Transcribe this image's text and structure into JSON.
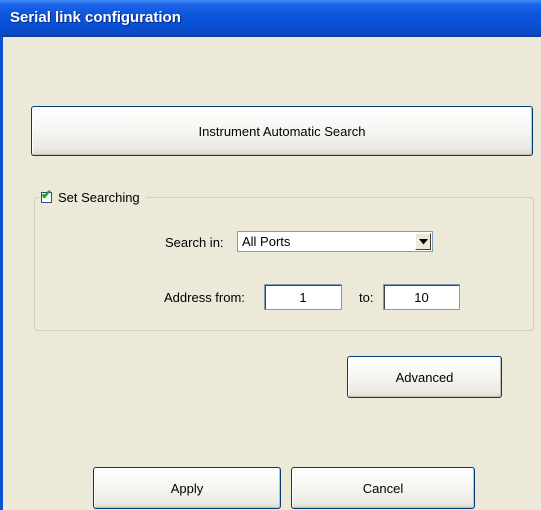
{
  "window": {
    "title": "Serial link configuration"
  },
  "search_button": {
    "label": "Instrument Automatic Search"
  },
  "set_searching": {
    "label": "Set Searching",
    "checked": true
  },
  "search_in": {
    "label": "Search in:",
    "selected": "All Ports"
  },
  "address": {
    "from_label": "Address from:",
    "from_value": "1",
    "to_label": "to:",
    "to_value": "10"
  },
  "buttons": {
    "advanced": "Advanced",
    "apply": "Apply",
    "cancel": "Cancel"
  },
  "colors": {
    "titlebar": "#0a4fd4",
    "window_bg": "#ece9d8",
    "button_border": "#003c74"
  }
}
